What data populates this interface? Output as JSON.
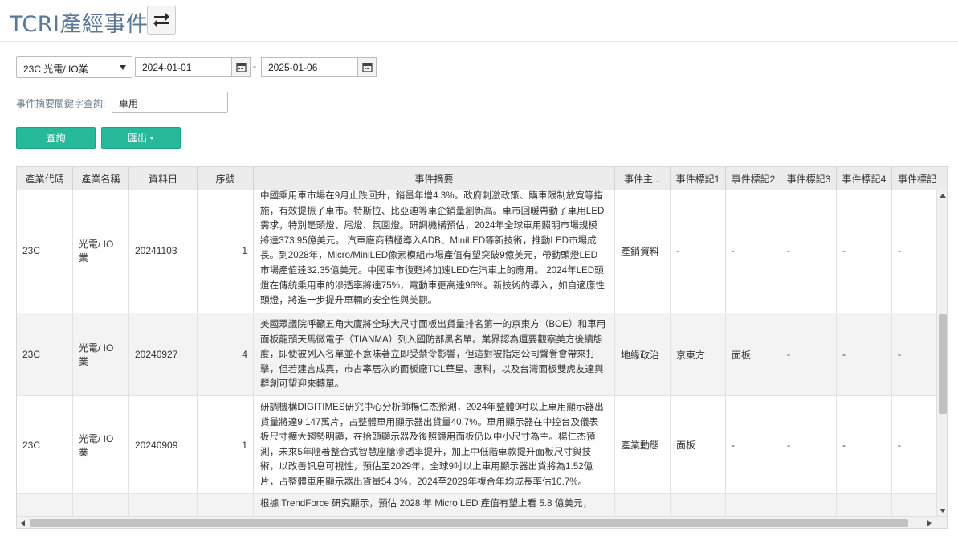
{
  "page": {
    "title": "TCRI產經事件"
  },
  "filters": {
    "industry_selected": "23C 光電/ IO業",
    "date_from": "2024-01-01",
    "date_to": "2025-01-06",
    "date_separator": "-",
    "keyword_label": "事件摘要關鍵字查詢:",
    "keyword_value": "車用"
  },
  "actions": {
    "query_label": "查詢",
    "export_label": "匯出"
  },
  "table": {
    "headers": [
      "產業代碼",
      "產業名稱",
      "資料日",
      "序號",
      "事件摘要",
      "事件主...",
      "事件標記1",
      "事件標記2",
      "事件標記3",
      "事件標記4",
      "事件標記"
    ],
    "rows": [
      {
        "code": "23C",
        "name": "光電/ IO業",
        "date": "20241103",
        "seq": "1",
        "summary_lines": [
          "中國乘用車市場在9月止跌回升，銷量年增4.3%。政府刺激政策、購車限制放寬等措",
          "施，有效提振了車市。特斯拉、比亞迪等車企銷量創新高。車市回暖帶動了車用LED",
          "需求，特別是頭燈、尾燈、氛圍燈。研調機構預估，2024年全球車用照明市場規模",
          "將達373.95億美元。 汽車廠商積極導入ADB、MiniLED等新技術，推動LED市場成",
          "長。到2028年，Micro/MiniLED像素模組市場產值有望突破9億美元，帶動頭燈LED",
          "市場產值達32.35億美元。中國車市復甦將加速LED在汽車上的應用。 2024年LED頭",
          "燈在傳統乘用車的滲透率將達75%，電動車更高達96%。新技術的導入，如自適應性",
          "頭燈，將進一步提升車輛的安全性與美觀。"
        ],
        "subject": "產銷資料",
        "tag1": "-",
        "tag2": "-",
        "tag3": "-",
        "tag4": "-",
        "tag5": "-"
      },
      {
        "code": "23C",
        "name": "光電/ IO業",
        "date": "20240927",
        "seq": "4",
        "summary_lines": [
          "美國眾議院呼籲五角大廈將全球大尺寸面板出貨量排名第一的京東方（BOE）和車用",
          "面板龍頭天馬微電子（TIANMA）列入國防部黑名單。業界認為還要觀察美方後續態",
          "度，即使被列入名單並不意味著立即受禁令影響，但這對被指定公司聲譽會帶來打",
          "擊，但若建言成真，市占率居次的面板廠TCL華星、惠科，以及台灣面板雙虎友達與",
          "群創可望迎來轉單。"
        ],
        "subject": "地緣政治",
        "tag1": "京東方",
        "tag2": "面板",
        "tag3": "-",
        "tag4": "-",
        "tag5": "-"
      },
      {
        "code": "23C",
        "name": "光電/ IO業",
        "date": "20240909",
        "seq": "1",
        "summary_lines": [
          "研調機構DIGITIMES研究中心分析師楊仁杰預測，2024年整體9吋以上車用顯示器出",
          "貨量將達9,147萬片，占整體車用顯示器出貨量40.7%。車用顯示器在中控台及儀表",
          "板尺寸擴大趨勢明顯，在抬頭顯示器及後照鏡用面板仍以中小尺寸為主。楊仁杰預",
          "測，未來5年隨著整合式智慧座艙滲透率提升，加上中低階車款提升面板尺寸與技",
          "術，以改善訊息可視性，預估至2029年，全球9吋以上車用顯示器出貨將為1.52億",
          "片，占整體車用顯示器出貨量54.3%，2024至2029年複合年均成長率估10.7%。"
        ],
        "subject": "產業動態",
        "tag1": "面板",
        "tag2": "-",
        "tag3": "-",
        "tag4": "-",
        "tag5": "-"
      },
      {
        "code": "",
        "name": "",
        "date": "",
        "seq": "",
        "summary_lines": [
          "根據 TrendForce 研究顯示，預估 2028 年 Micro LED 產值有望上看 5.8 億美元，"
        ],
        "subject": "",
        "tag1": "",
        "tag2": "",
        "tag3": "",
        "tag4": "",
        "tag5": ""
      }
    ]
  }
}
